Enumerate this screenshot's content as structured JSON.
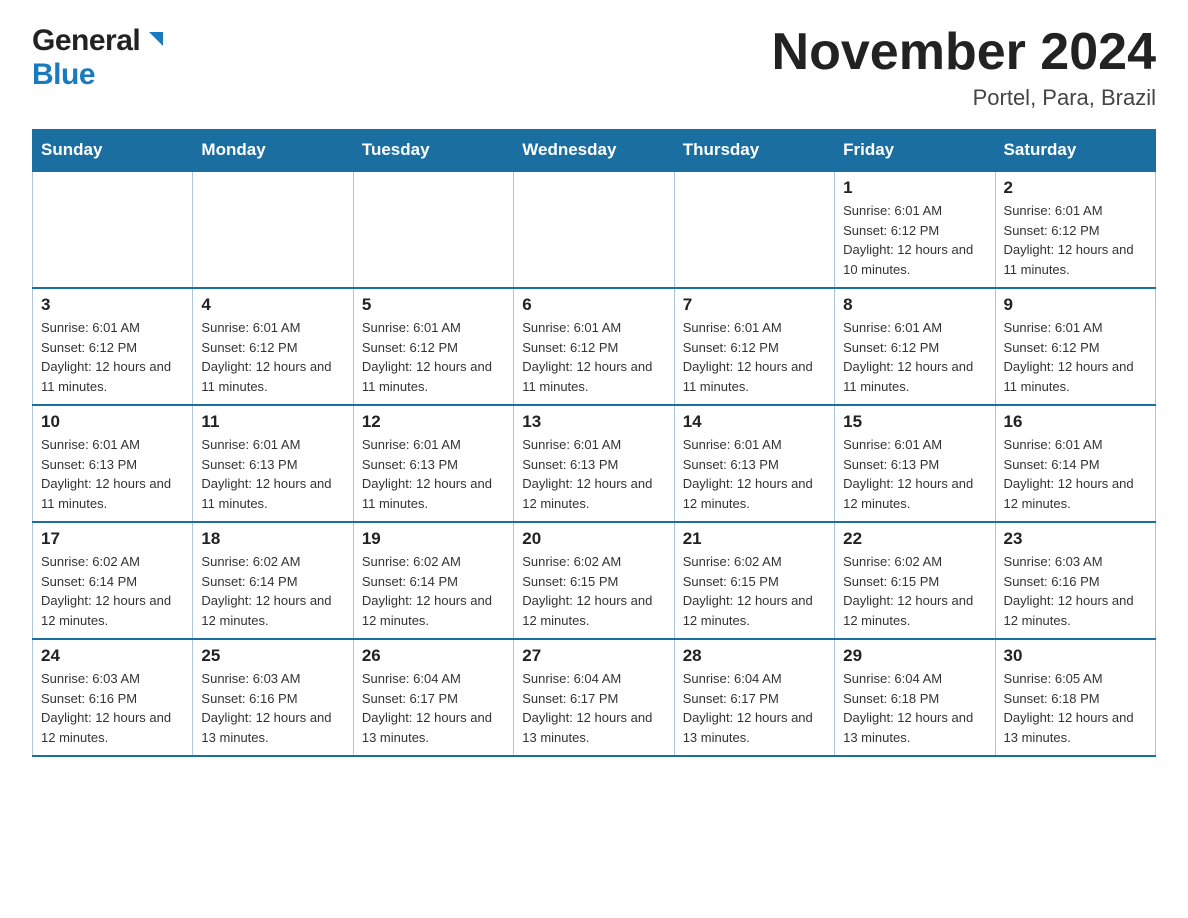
{
  "header": {
    "logo_general": "General",
    "logo_blue": "Blue",
    "month_title": "November 2024",
    "location": "Portel, Para, Brazil"
  },
  "weekdays": [
    "Sunday",
    "Monday",
    "Tuesday",
    "Wednesday",
    "Thursday",
    "Friday",
    "Saturday"
  ],
  "weeks": [
    [
      {
        "day": "",
        "sunrise": "",
        "sunset": "",
        "daylight": ""
      },
      {
        "day": "",
        "sunrise": "",
        "sunset": "",
        "daylight": ""
      },
      {
        "day": "",
        "sunrise": "",
        "sunset": "",
        "daylight": ""
      },
      {
        "day": "",
        "sunrise": "",
        "sunset": "",
        "daylight": ""
      },
      {
        "day": "",
        "sunrise": "",
        "sunset": "",
        "daylight": ""
      },
      {
        "day": "1",
        "sunrise": "Sunrise: 6:01 AM",
        "sunset": "Sunset: 6:12 PM",
        "daylight": "Daylight: 12 hours and 10 minutes."
      },
      {
        "day": "2",
        "sunrise": "Sunrise: 6:01 AM",
        "sunset": "Sunset: 6:12 PM",
        "daylight": "Daylight: 12 hours and 11 minutes."
      }
    ],
    [
      {
        "day": "3",
        "sunrise": "Sunrise: 6:01 AM",
        "sunset": "Sunset: 6:12 PM",
        "daylight": "Daylight: 12 hours and 11 minutes."
      },
      {
        "day": "4",
        "sunrise": "Sunrise: 6:01 AM",
        "sunset": "Sunset: 6:12 PM",
        "daylight": "Daylight: 12 hours and 11 minutes."
      },
      {
        "day": "5",
        "sunrise": "Sunrise: 6:01 AM",
        "sunset": "Sunset: 6:12 PM",
        "daylight": "Daylight: 12 hours and 11 minutes."
      },
      {
        "day": "6",
        "sunrise": "Sunrise: 6:01 AM",
        "sunset": "Sunset: 6:12 PM",
        "daylight": "Daylight: 12 hours and 11 minutes."
      },
      {
        "day": "7",
        "sunrise": "Sunrise: 6:01 AM",
        "sunset": "Sunset: 6:12 PM",
        "daylight": "Daylight: 12 hours and 11 minutes."
      },
      {
        "day": "8",
        "sunrise": "Sunrise: 6:01 AM",
        "sunset": "Sunset: 6:12 PM",
        "daylight": "Daylight: 12 hours and 11 minutes."
      },
      {
        "day": "9",
        "sunrise": "Sunrise: 6:01 AM",
        "sunset": "Sunset: 6:12 PM",
        "daylight": "Daylight: 12 hours and 11 minutes."
      }
    ],
    [
      {
        "day": "10",
        "sunrise": "Sunrise: 6:01 AM",
        "sunset": "Sunset: 6:13 PM",
        "daylight": "Daylight: 12 hours and 11 minutes."
      },
      {
        "day": "11",
        "sunrise": "Sunrise: 6:01 AM",
        "sunset": "Sunset: 6:13 PM",
        "daylight": "Daylight: 12 hours and 11 minutes."
      },
      {
        "day": "12",
        "sunrise": "Sunrise: 6:01 AM",
        "sunset": "Sunset: 6:13 PM",
        "daylight": "Daylight: 12 hours and 11 minutes."
      },
      {
        "day": "13",
        "sunrise": "Sunrise: 6:01 AM",
        "sunset": "Sunset: 6:13 PM",
        "daylight": "Daylight: 12 hours and 12 minutes."
      },
      {
        "day": "14",
        "sunrise": "Sunrise: 6:01 AM",
        "sunset": "Sunset: 6:13 PM",
        "daylight": "Daylight: 12 hours and 12 minutes."
      },
      {
        "day": "15",
        "sunrise": "Sunrise: 6:01 AM",
        "sunset": "Sunset: 6:13 PM",
        "daylight": "Daylight: 12 hours and 12 minutes."
      },
      {
        "day": "16",
        "sunrise": "Sunrise: 6:01 AM",
        "sunset": "Sunset: 6:14 PM",
        "daylight": "Daylight: 12 hours and 12 minutes."
      }
    ],
    [
      {
        "day": "17",
        "sunrise": "Sunrise: 6:02 AM",
        "sunset": "Sunset: 6:14 PM",
        "daylight": "Daylight: 12 hours and 12 minutes."
      },
      {
        "day": "18",
        "sunrise": "Sunrise: 6:02 AM",
        "sunset": "Sunset: 6:14 PM",
        "daylight": "Daylight: 12 hours and 12 minutes."
      },
      {
        "day": "19",
        "sunrise": "Sunrise: 6:02 AM",
        "sunset": "Sunset: 6:14 PM",
        "daylight": "Daylight: 12 hours and 12 minutes."
      },
      {
        "day": "20",
        "sunrise": "Sunrise: 6:02 AM",
        "sunset": "Sunset: 6:15 PM",
        "daylight": "Daylight: 12 hours and 12 minutes."
      },
      {
        "day": "21",
        "sunrise": "Sunrise: 6:02 AM",
        "sunset": "Sunset: 6:15 PM",
        "daylight": "Daylight: 12 hours and 12 minutes."
      },
      {
        "day": "22",
        "sunrise": "Sunrise: 6:02 AM",
        "sunset": "Sunset: 6:15 PM",
        "daylight": "Daylight: 12 hours and 12 minutes."
      },
      {
        "day": "23",
        "sunrise": "Sunrise: 6:03 AM",
        "sunset": "Sunset: 6:16 PM",
        "daylight": "Daylight: 12 hours and 12 minutes."
      }
    ],
    [
      {
        "day": "24",
        "sunrise": "Sunrise: 6:03 AM",
        "sunset": "Sunset: 6:16 PM",
        "daylight": "Daylight: 12 hours and 12 minutes."
      },
      {
        "day": "25",
        "sunrise": "Sunrise: 6:03 AM",
        "sunset": "Sunset: 6:16 PM",
        "daylight": "Daylight: 12 hours and 13 minutes."
      },
      {
        "day": "26",
        "sunrise": "Sunrise: 6:04 AM",
        "sunset": "Sunset: 6:17 PM",
        "daylight": "Daylight: 12 hours and 13 minutes."
      },
      {
        "day": "27",
        "sunrise": "Sunrise: 6:04 AM",
        "sunset": "Sunset: 6:17 PM",
        "daylight": "Daylight: 12 hours and 13 minutes."
      },
      {
        "day": "28",
        "sunrise": "Sunrise: 6:04 AM",
        "sunset": "Sunset: 6:17 PM",
        "daylight": "Daylight: 12 hours and 13 minutes."
      },
      {
        "day": "29",
        "sunrise": "Sunrise: 6:04 AM",
        "sunset": "Sunset: 6:18 PM",
        "daylight": "Daylight: 12 hours and 13 minutes."
      },
      {
        "day": "30",
        "sunrise": "Sunrise: 6:05 AM",
        "sunset": "Sunset: 6:18 PM",
        "daylight": "Daylight: 12 hours and 13 minutes."
      }
    ]
  ]
}
